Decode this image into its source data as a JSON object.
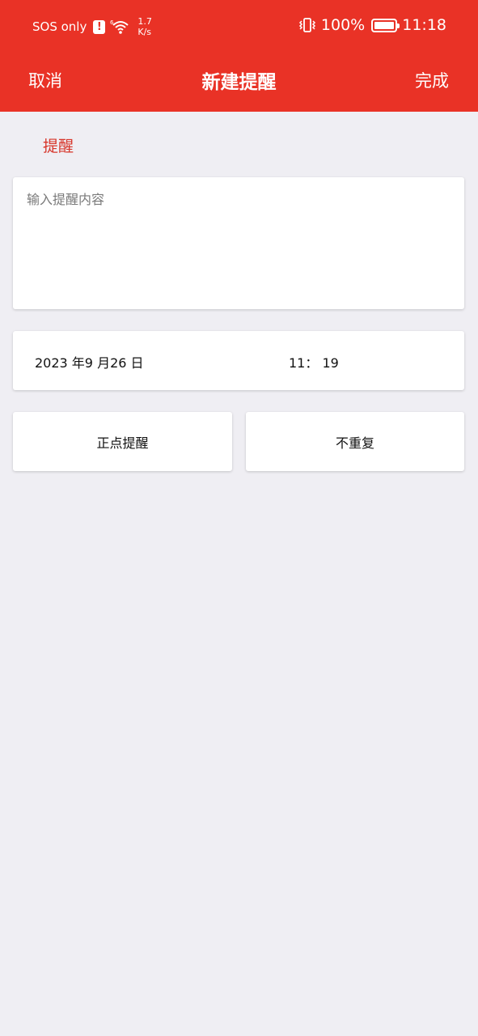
{
  "status_bar": {
    "carrier": "SOS only",
    "sos_badge": "!",
    "wifi_gen": "6",
    "net_speed_value": "1.7",
    "net_speed_unit": "K/s",
    "battery": "100%",
    "time": "11:18"
  },
  "header": {
    "cancel_label": "取消",
    "title": "新建提醒",
    "done_label": "完成"
  },
  "section": {
    "label": "提醒"
  },
  "reminder": {
    "content_value": "",
    "content_placeholder": "输入提醒内容"
  },
  "schedule": {
    "date": "2023 年9 月26 日",
    "time": "11： 19"
  },
  "options": {
    "alert_mode": "正点提醒",
    "repeat": "不重复"
  },
  "colors": {
    "accent": "#e93226",
    "background": "#efeef3",
    "label_red": "#d7352a"
  },
  "icons": [
    "sos-badge-icon",
    "wifi-icon",
    "vibrate-icon",
    "battery-icon"
  ]
}
